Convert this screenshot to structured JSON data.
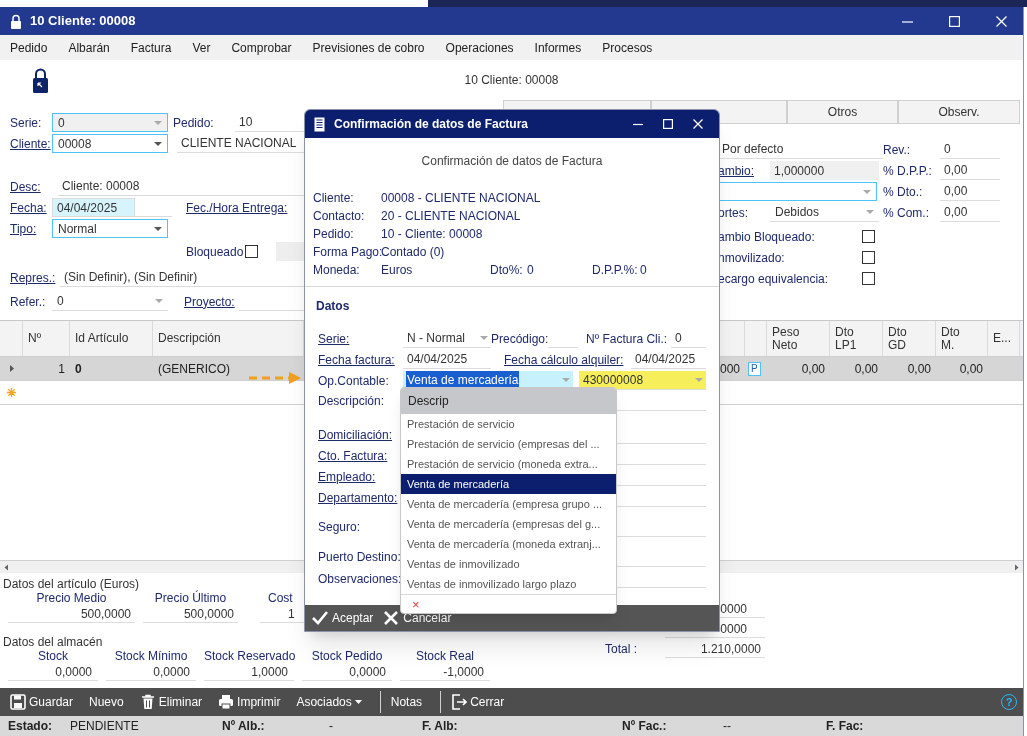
{
  "window": {
    "title": "10 Cliente: 00008"
  },
  "menu": [
    "Pedido",
    "Albarán",
    "Factura",
    "Ver",
    "Comprobar",
    "Previsiones de cobro",
    "Operaciones",
    "Informes",
    "Procesos"
  ],
  "caption": "10 Cliente: 00008",
  "order_form": {
    "serie": {
      "label": "Serie:",
      "link": false,
      "value": "0"
    },
    "pedido": {
      "label": "Pedido:",
      "link": false,
      "value": "10"
    },
    "cliente": {
      "label": "Cliente:",
      "link": true,
      "value": "00008",
      "name": "CLIENTE NACIONAL"
    },
    "desc": {
      "label": "Desc:",
      "link": true,
      "value": "Cliente: 00008"
    },
    "fecha": {
      "label": "Fecha:",
      "link": true,
      "value": "04/04/2025"
    },
    "entrega": {
      "label": "Fec./Hora Entrega:",
      "link": true
    },
    "tipo": {
      "label": "Tipo:",
      "link": true,
      "value": "Normal"
    },
    "bloqueado": {
      "label": "Bloqueado",
      "checked": false
    },
    "repres": {
      "label": "Repres.:",
      "link": true,
      "value": "(Sin Definir), (Sin Definir)"
    },
    "refer": {
      "label": "Refer.:",
      "link": false,
      "value": "0"
    },
    "proyecto": {
      "label": "Proyecto:",
      "link": true
    }
  },
  "tabs": [
    {
      "label": "Otros",
      "selected": false
    },
    {
      "label": "Observ.",
      "selected": false
    }
  ],
  "conditions": {
    "tarifa": "Por defecto",
    "cambio": {
      "label": "ambio:",
      "link": true,
      "value": "1,000000"
    },
    "portes": {
      "label": "ortes:",
      "value": "Debidos"
    },
    "right": [
      {
        "label": "Rev.:",
        "value": "0"
      },
      {
        "label": "% D.P.P.:",
        "value": "0,00"
      },
      {
        "label": "% Dto.:",
        "value": "0,00"
      },
      {
        "label": "% Com.:",
        "value": "0,00"
      }
    ],
    "checks": [
      {
        "label": "ambio Bloqueado:",
        "checked": false
      },
      {
        "label": "nmovilizado:",
        "checked": false
      },
      {
        "label": "ecargo equivalencia:",
        "checked": false
      }
    ]
  },
  "grid": {
    "columns": [
      "Nº",
      "Id Artículo",
      "Descripción",
      "Peso Neto",
      "Dto LP1",
      "Dto GD",
      "Dto M.",
      "E..."
    ],
    "rows": [
      {
        "selected": true,
        "cells": [
          "1",
          "0",
          "(GENERICO)",
          "000",
          "P",
          "0,00",
          "0,00",
          "0,00",
          "0,00"
        ]
      }
    ]
  },
  "article": {
    "title": "Datos del artículo (Euros)",
    "fields": [
      {
        "label": "Precio Medio",
        "value": "500,0000"
      },
      {
        "label": "Precio Último",
        "value": "500,0000"
      },
      {
        "label": "Cost",
        "value": "1"
      }
    ]
  },
  "warehouse": {
    "title": "Datos del almacén",
    "fields": [
      {
        "label": "Stock",
        "value": "0,0000"
      },
      {
        "label": "Stock Mínimo",
        "value": "0,0000"
      },
      {
        "label": "Stock Reservado",
        "value": "1,0000"
      },
      {
        "label": "Stock Pedido",
        "value": "0,0000"
      },
      {
        "label": "Stock Real",
        "value": "-1,0000"
      }
    ]
  },
  "totals": [
    "0000",
    "0000"
  ],
  "total": {
    "label": "Total :",
    "value": "1.210,0000"
  },
  "toolbar": [
    {
      "kind": "button",
      "label": "Guardar"
    },
    {
      "kind": "button",
      "label": "Nuevo"
    },
    {
      "kind": "button",
      "label": "Eliminar"
    },
    {
      "kind": "button",
      "label": "Imprimir"
    },
    {
      "kind": "menu",
      "label": "Asociados"
    },
    {
      "kind": "separator"
    },
    {
      "kind": "button",
      "label": "Notas"
    },
    {
      "kind": "separator"
    },
    {
      "kind": "button",
      "label": "Cerrar"
    }
  ],
  "help": "?",
  "status_bar": [
    {
      "label": "Estado:",
      "value": "PENDIENTE"
    },
    {
      "label": "Nº Alb.:",
      "value": "-"
    },
    {
      "label": "F. Alb:"
    },
    {
      "label": "Nº Fac.:",
      "value": "--"
    },
    {
      "label": "F. Fac:"
    }
  ],
  "dialog": {
    "title": "Confirmación de datos de Factura",
    "heading": "Confirmación de datos de Factura",
    "info": [
      {
        "label": "Cliente:",
        "value": "00008 - CLIENTE NACIONAL"
      },
      {
        "label": "Contacto:",
        "value": "20 - CLIENTE NACIONAL"
      },
      {
        "label": "Pedido:",
        "value": "10 - Cliente: 00008"
      },
      {
        "label": "Forma Pago:",
        "value": "Contado (0)"
      },
      {
        "label": "Moneda:",
        "value": "Euros"
      }
    ],
    "info_extra": [
      {
        "label": "Dto%:",
        "value": "0"
      },
      {
        "label": "D.P.P.%:",
        "value": "0"
      }
    ],
    "section": "Datos",
    "rows": [
      [
        {
          "label": "Serie:",
          "link": true,
          "kind": "combo",
          "value": "N - Normal"
        },
        {
          "label": "Precódigo:",
          "link": false,
          "kind": "text"
        },
        {
          "label": "Nº Factura Cli.:",
          "link": false,
          "kind": "text",
          "value": "0"
        }
      ],
      [
        {
          "label": "Fecha factura:",
          "link": true,
          "kind": "text",
          "value": "04/04/2025"
        },
        {
          "label": "Fecha cálculo alquiler:",
          "link": true,
          "kind": "text",
          "value": "04/04/2025"
        }
      ],
      [
        {
          "label": "Op.Contable:",
          "link": false,
          "kind": "combo",
          "value": "Venta de mercadería",
          "focused": true
        },
        {
          "kind": "combo",
          "value": "430000008",
          "highlighted": true
        }
      ],
      [
        {
          "label": "Descripción:",
          "link": false,
          "kind": "text"
        }
      ],
      [
        {
          "label": "Domiciliación:",
          "link": true,
          "kind": "text"
        }
      ],
      [
        {
          "label": "Cto. Factura:",
          "link": true,
          "kind": "text"
        }
      ],
      [
        {
          "label": "Empleado:",
          "link": true,
          "kind": "text"
        }
      ],
      [
        {
          "label": "Departamento:",
          "link": true,
          "kind": "text"
        }
      ],
      [
        {
          "label": "Seguro:",
          "link": false,
          "kind": "text"
        }
      ],
      [
        {
          "label": "Puerto Destino:",
          "link": false,
          "kind": "text"
        }
      ],
      [
        {
          "label": "Observaciones:",
          "link": false,
          "kind": "text"
        }
      ]
    ],
    "dropdown": {
      "header": "Descrip",
      "items": [
        {
          "label": "Prestación de servicio",
          "selected": false
        },
        {
          "label": "Prestación de servicio (empresas del ...",
          "selected": false
        },
        {
          "label": "Prestación de servicio (moneda extra...",
          "selected": false
        },
        {
          "label": "Venta de mercadería",
          "selected": true
        },
        {
          "label": "Venta de mercadería (empresa grupo ...",
          "selected": false
        },
        {
          "label": "Venta de mercadería (empresas del g...",
          "selected": false
        },
        {
          "label": "Venta de mercadería (moneda extranj...",
          "selected": false
        },
        {
          "label": "Ventas de inmovilizado",
          "selected": false
        },
        {
          "label": "Ventas de inmovilizado largo plazo",
          "selected": false
        }
      ],
      "clear": "×"
    },
    "buttons": [
      {
        "label": "Aceptar"
      },
      {
        "label": "Cancelar"
      }
    ]
  }
}
